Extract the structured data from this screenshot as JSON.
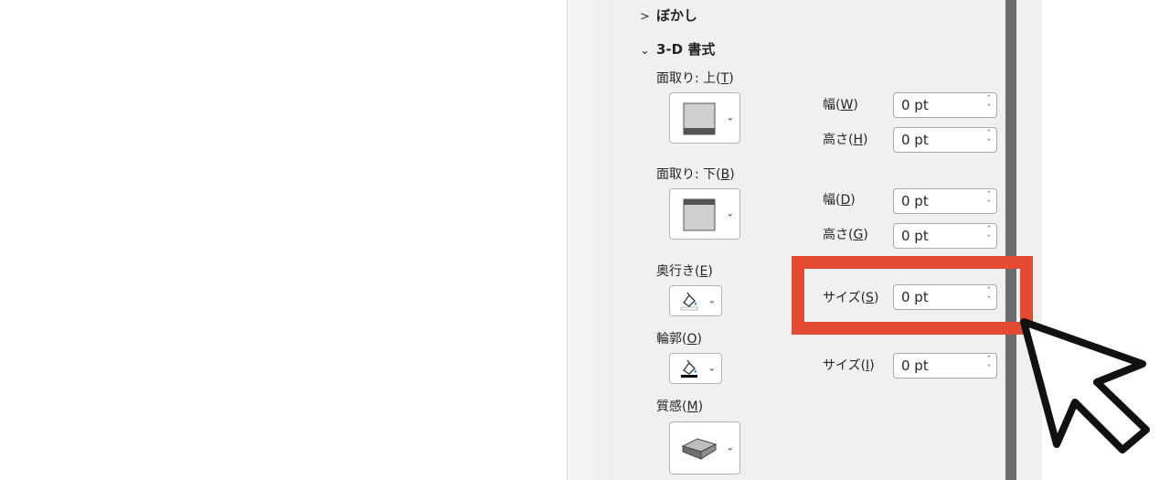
{
  "sections": {
    "blur": {
      "label": "ぼかし",
      "expanded": false
    },
    "format3d": {
      "label": "3-D 書式",
      "expanded": true
    }
  },
  "bevel_top": {
    "label_prefix": "面取り: 上(",
    "label_key": "T",
    "label_suffix": ")",
    "width": {
      "label_prefix": "幅(",
      "key": "W",
      "label_suffix": ")",
      "value": "0 pt"
    },
    "height": {
      "label_prefix": "高さ(",
      "key": "H",
      "label_suffix": ")",
      "value": "0 pt"
    }
  },
  "bevel_bottom": {
    "label_prefix": "面取り: 下(",
    "label_key": "B",
    "label_suffix": ")",
    "width": {
      "label_prefix": "幅(",
      "key": "D",
      "label_suffix": ")",
      "value": "0 pt"
    },
    "height": {
      "label_prefix": "高さ(",
      "key": "G",
      "label_suffix": ")",
      "value": "0 pt"
    }
  },
  "depth": {
    "label_prefix": "奥行き(",
    "label_key": "E",
    "label_suffix": ")",
    "size": {
      "label_prefix": "サイズ(",
      "key": "S",
      "label_suffix": ")",
      "value": "0 pt"
    }
  },
  "contour": {
    "label_prefix": "輪郭(",
    "label_key": "O",
    "label_suffix": ")",
    "size": {
      "label_prefix": "サイズ(",
      "key": "I",
      "label_suffix": ")",
      "value": "0 pt"
    }
  },
  "material": {
    "label_prefix": "質感(",
    "label_key": "M",
    "label_suffix": ")"
  },
  "icons": {
    "bevel_top": "bevel-top-icon",
    "bevel_bottom": "bevel-bottom-icon",
    "depth_color": "paint-bucket-icon",
    "contour_color": "paint-bucket-icon",
    "material": "material-plastic-icon",
    "pointer": "mouse-cursor-icon"
  },
  "colors": {
    "highlight": "#e34a32",
    "pane_bg": "#f0f0f0",
    "scrollbar": "#6b6b6b",
    "contour_swatch": "#000000",
    "depth_swatch": "#ffffff"
  }
}
